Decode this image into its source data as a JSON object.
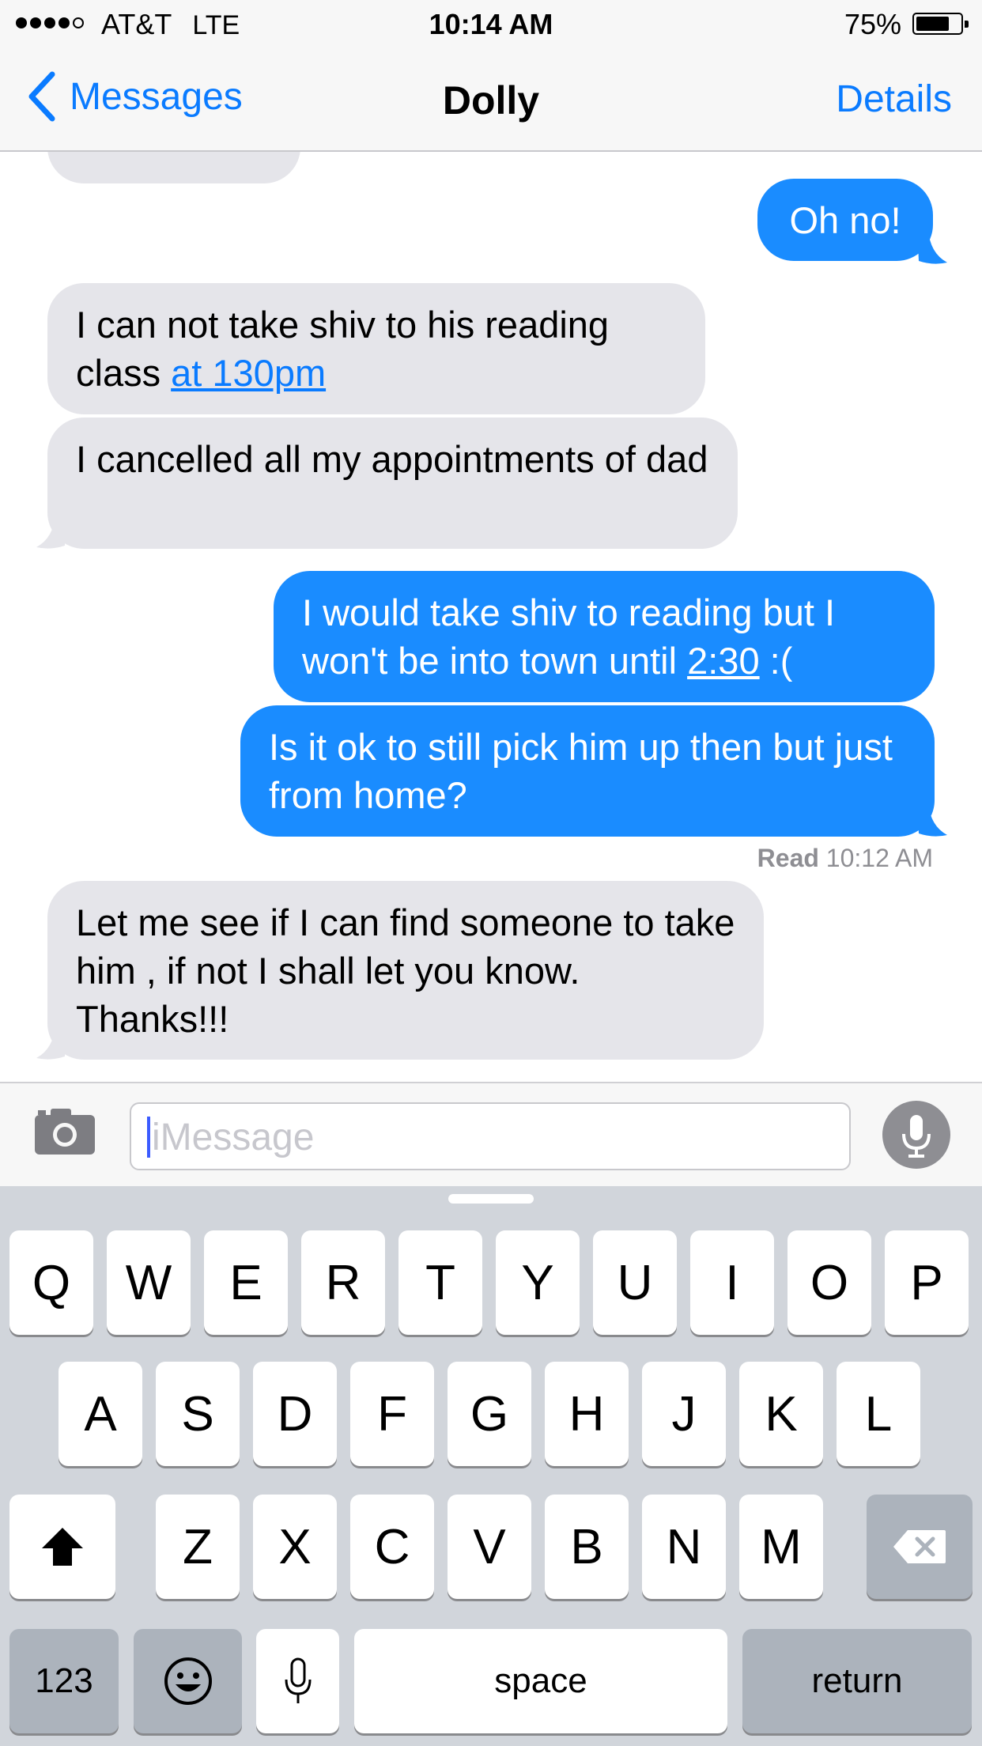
{
  "status_bar": {
    "carrier": "AT&T",
    "network": "LTE",
    "time": "10:14 AM",
    "battery_percent": "75%",
    "battery_level": 0.75
  },
  "nav": {
    "back_label": "Messages",
    "title": "Dolly",
    "details_label": "Details"
  },
  "messages": [
    {
      "direction": "outgoing",
      "text": "Oh no!"
    },
    {
      "direction": "incoming",
      "text_before": "I can not take shiv to his reading class ",
      "link": "at 130pm"
    },
    {
      "direction": "incoming",
      "text": "I cancelled all my appointments of dad"
    },
    {
      "direction": "outgoing",
      "text_before": "I would take shiv to reading but I won't be into town until ",
      "link": "2:30",
      "text_after": " :("
    },
    {
      "direction": "outgoing",
      "text": "Is it ok to still pick him up then but just from home?"
    },
    {
      "direction": "incoming",
      "text": "Let me see if I can find someone to take him , if not I shall let you know. Thanks!!!"
    }
  ],
  "read_receipt": {
    "label": "Read",
    "time": "10:12 AM"
  },
  "input": {
    "placeholder": "iMessage",
    "value": ""
  },
  "keyboard": {
    "row1": [
      "Q",
      "W",
      "E",
      "R",
      "T",
      "Y",
      "U",
      "I",
      "O",
      "P"
    ],
    "row2": [
      "A",
      "S",
      "D",
      "F",
      "G",
      "H",
      "J",
      "K",
      "L"
    ],
    "row3": [
      "Z",
      "X",
      "C",
      "V",
      "B",
      "N",
      "M"
    ],
    "numbers_label": "123",
    "space_label": "space",
    "return_label": "return"
  },
  "colors": {
    "accent": "#0a7bff",
    "outgoing_bubble": "#1a8cff",
    "incoming_bubble": "#e5e5ea",
    "keyboard_bg": "#d1d5db"
  }
}
